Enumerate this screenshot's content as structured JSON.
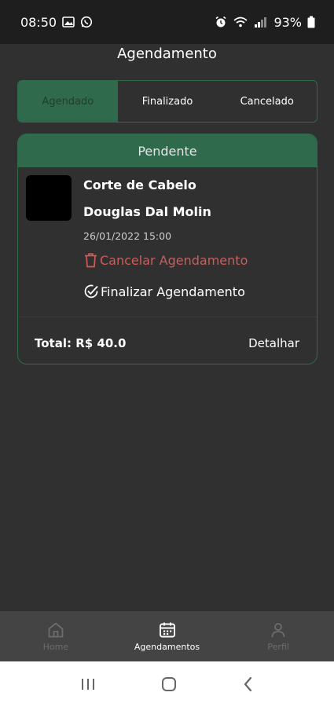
{
  "status_bar": {
    "time": "08:50",
    "battery": "93%"
  },
  "header": {
    "title": "Agendamento"
  },
  "tabs": [
    {
      "label": "Agendado",
      "active": true
    },
    {
      "label": "Finalizado",
      "active": false
    },
    {
      "label": "Cancelado",
      "active": false
    }
  ],
  "card": {
    "status": "Pendente",
    "service": "Corte de Cabelo",
    "professional": "Douglas Dal Molin",
    "datetime": "26/01/2022 15:00",
    "cancel_label": "Cancelar Agendamento",
    "finish_label": "Finalizar Agendamento",
    "total": "Total: R$ 40.0",
    "detail_label": "Detalhar"
  },
  "bottom_nav": [
    {
      "label": "Home",
      "icon": "home-icon",
      "active": false
    },
    {
      "label": "Agendamentos",
      "icon": "calendar-icon",
      "active": true
    },
    {
      "label": "Perfil",
      "icon": "person-icon",
      "active": false
    }
  ],
  "colors": {
    "accent": "#2f6a4c",
    "background": "#303030",
    "danger": "#cf5b5b",
    "nav_background": "#444444"
  }
}
